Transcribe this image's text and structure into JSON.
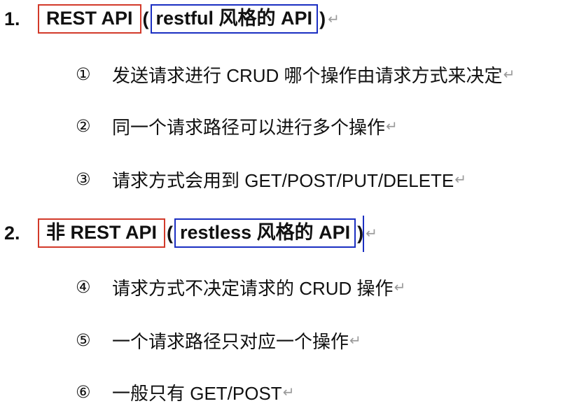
{
  "section1": {
    "number": "1.",
    "red_label": "REST API",
    "open_paren": "(",
    "blue_label": "restful 风格的 API",
    "close_paren": ")",
    "items": [
      {
        "marker": "①",
        "text": "发送请求进行 CRUD 哪个操作由请求方式来决定"
      },
      {
        "marker": "②",
        "text": "同一个请求路径可以进行多个操作"
      },
      {
        "marker": "③",
        "text": "请求方式会用到 GET/POST/PUT/DELETE"
      }
    ]
  },
  "section2": {
    "number": "2.",
    "red_label": "非 REST API",
    "open_paren": "(",
    "blue_label": "restless 风格的 API",
    "close_paren": ")",
    "items": [
      {
        "marker": "④",
        "text": "请求方式不决定请求的 CRUD 操作"
      },
      {
        "marker": "⑤",
        "text": "一个请求路径只对应一个操作"
      },
      {
        "marker": "⑥",
        "text": "一般只有 GET/POST"
      }
    ]
  },
  "paragraph_mark": "↵",
  "colors": {
    "red_box": "#d23a2a",
    "blue_box": "#1b2fc2",
    "paragraph_mark": "#9a9a9a"
  }
}
